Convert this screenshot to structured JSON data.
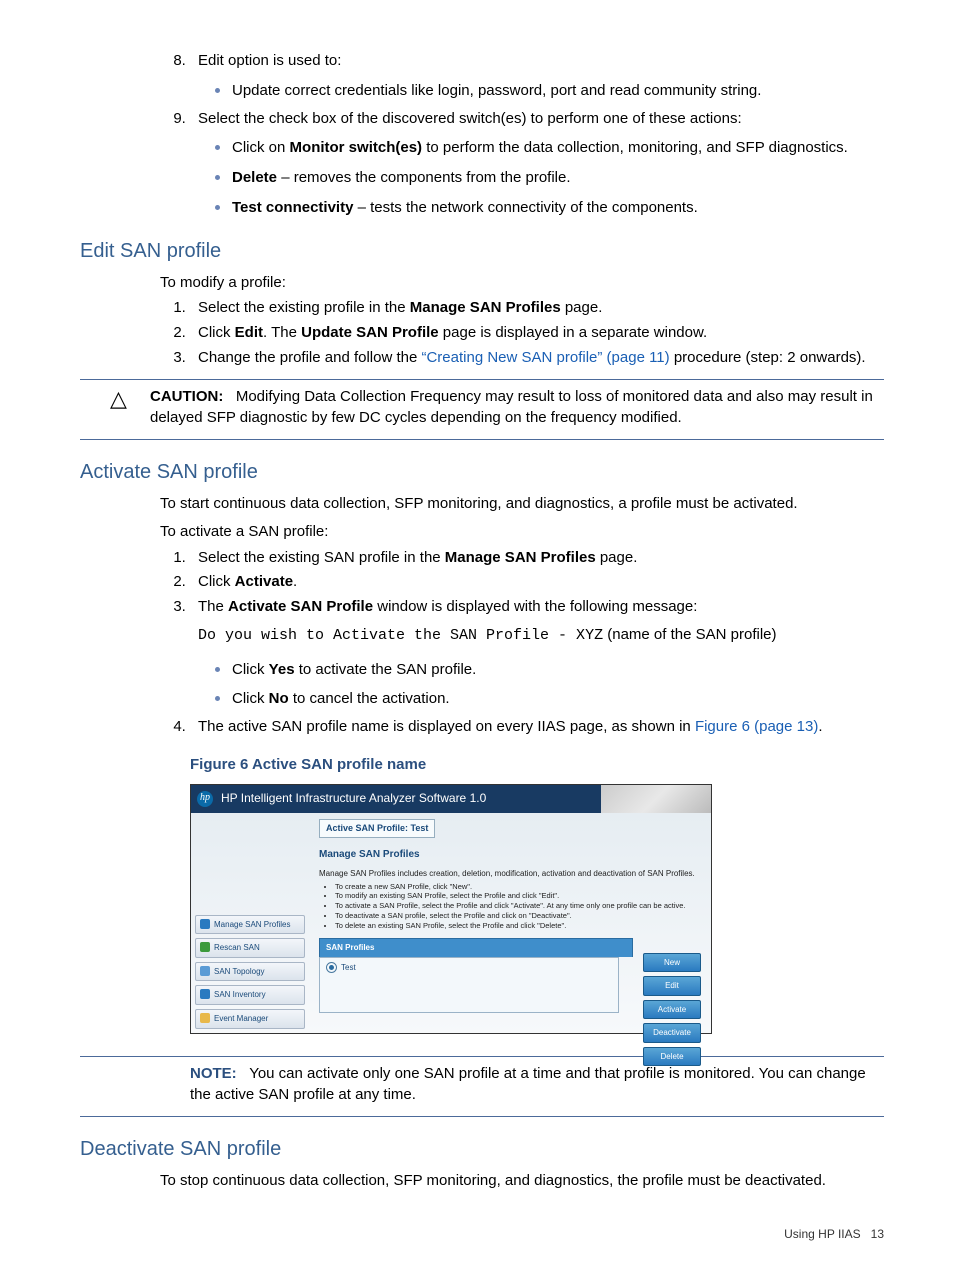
{
  "item8": {
    "num": "8.",
    "text": "Edit option is used to:",
    "bullet": "Update correct credentials like login, password, port and read community string."
  },
  "item9": {
    "num": "9.",
    "text": "Select the check box of the discovered switch(es) to perform one of these actions:",
    "b1a": "Click on ",
    "b1b": "Monitor switch(es)",
    "b1c": " to perform the data collection, monitoring, and SFP diagnostics.",
    "b2a": "Delete",
    "b2b": " – removes the components from the profile.",
    "b3a": "Test connectivity",
    "b3b": " – tests the network connectivity of the components."
  },
  "edit": {
    "heading": "Edit SAN profile",
    "intro": "To modify a profile:",
    "s1a": "Select the existing profile in the ",
    "s1b": "Manage SAN Profiles",
    "s1c": " page.",
    "s2a": "Click ",
    "s2b": "Edit",
    "s2c": ". The ",
    "s2d": "Update SAN Profile",
    "s2e": " page is displayed in a separate window.",
    "s3a": "Change the profile and follow the ",
    "s3link": "“Creating New SAN profile” (page 11)",
    "s3b": " procedure (step: 2 onwards)."
  },
  "caution": {
    "label": "CAUTION:",
    "text": "Modifying Data Collection Frequency may result to loss of monitored data and also may result in delayed SFP diagnostic by few DC cycles depending on the frequency modified."
  },
  "activate": {
    "heading": "Activate SAN profile",
    "p1": "To start continuous data collection, SFP monitoring, and diagnostics, a profile must be activated.",
    "p2": "To activate a SAN profile:",
    "s1a": "Select the existing SAN profile in the ",
    "s1b": "Manage SAN Profiles",
    "s1c": " page.",
    "s2a": "Click ",
    "s2b": "Activate",
    "s2c": ".",
    "s3a": "The ",
    "s3b": "Activate SAN Profile",
    "s3c": " window is displayed with the following message:",
    "s3code": "Do you wish to Activate the SAN Profile - XYZ",
    "s3tail": " (name of the SAN profile)",
    "s3b1a": "Click ",
    "s3b1b": "Yes",
    "s3b1c": " to activate the SAN profile.",
    "s3b2a": "Click ",
    "s3b2b": "No",
    "s3b2c": " to cancel the activation.",
    "s4a": "The active SAN profile name is displayed on every IIAS page, as shown in ",
    "s4link": "Figure 6 (page 13)",
    "s4b": "."
  },
  "figure": {
    "caption": "Figure 6 Active SAN profile name",
    "titlebar": "HP Intelligent Infrastructure Analyzer Software 1.0",
    "logo": "hp",
    "active_label": "Active SAN Profile:  Test",
    "main_heading": "Manage SAN Profiles",
    "desc": "Manage SAN Profiles includes creation, deletion, modification, activation and deactivation of SAN Profiles.",
    "bul1": "To create a new SAN Profile, click \"New\".",
    "bul2": "To modify an existing SAN Profile, select the Profile and click \"Edit\".",
    "bul3": "To activate a SAN Profile, select the Profile and click \"Activate\". At any time only one profile can be active.",
    "bul4": "To deactivate a SAN profile, select the Profile and click on \"Deactivate\".",
    "bul5": "To delete an existing SAN Profile, select the Profile and click \"Delete\".",
    "panel_head": "SAN Profiles",
    "row_label": "Test",
    "side1": "Manage SAN Profiles",
    "side2": "Rescan SAN",
    "side3": "SAN Topology",
    "side4": "SAN Inventory",
    "side5": "Event Manager",
    "btn_new": "New",
    "btn_edit": "Edit",
    "btn_activate": "Activate",
    "btn_deact": "Deactivate",
    "btn_delete": "Delete"
  },
  "note": {
    "label": "NOTE:",
    "text": "You can activate only one SAN profile at a time and that profile is monitored. You can change the active SAN profile at any time."
  },
  "deactivate": {
    "heading": "Deactivate SAN profile",
    "p1": "To stop continuous data collection, SFP monitoring, and diagnostics, the profile must be deactivated."
  },
  "footer": {
    "text": "Using HP IIAS",
    "page": "13"
  }
}
